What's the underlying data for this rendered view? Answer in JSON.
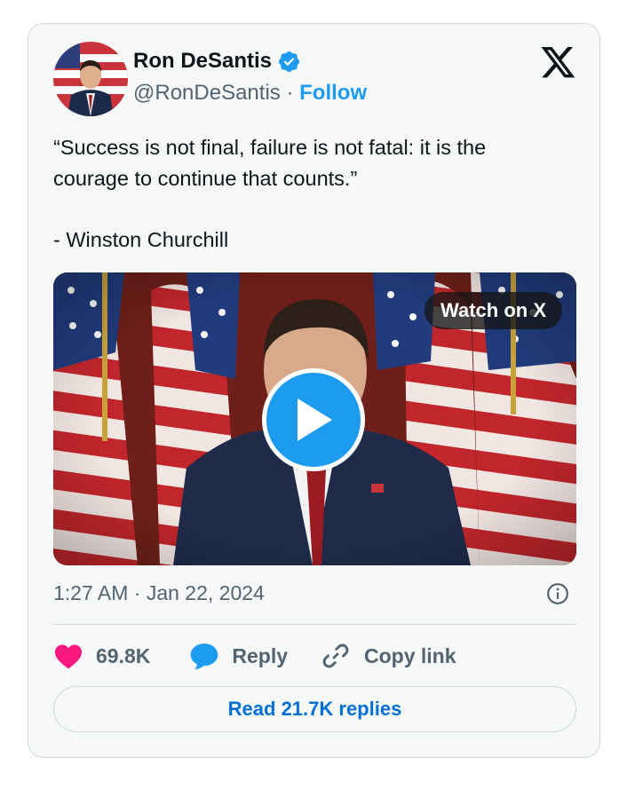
{
  "author": {
    "name": "Ron DeSantis",
    "handle": "@RonDeSantis",
    "separator": "·",
    "follow_label": "Follow"
  },
  "tweet": {
    "lines": [
      "“Success is not final, failure is not fatal: it is the",
      "courage to continue that counts.”"
    ],
    "attribution": "- Winston Churchill"
  },
  "media": {
    "watch_label": "Watch on X",
    "icon": "play-icon"
  },
  "meta": {
    "timestamp": "1:27 AM · Jan 22, 2024",
    "info_icon": "info-icon"
  },
  "actions": {
    "likes_count": "69.8K",
    "reply_label": "Reply",
    "copy_link_label": "Copy link"
  },
  "read_replies_label": "Read 21.7K replies",
  "colors": {
    "brand_blue": "#1d9bf0",
    "link_blue": "#006fd6",
    "heart_pink": "#f91880",
    "muted_text": "#536471",
    "card_bg": "#f7f9f9",
    "border": "#cfd9de"
  }
}
